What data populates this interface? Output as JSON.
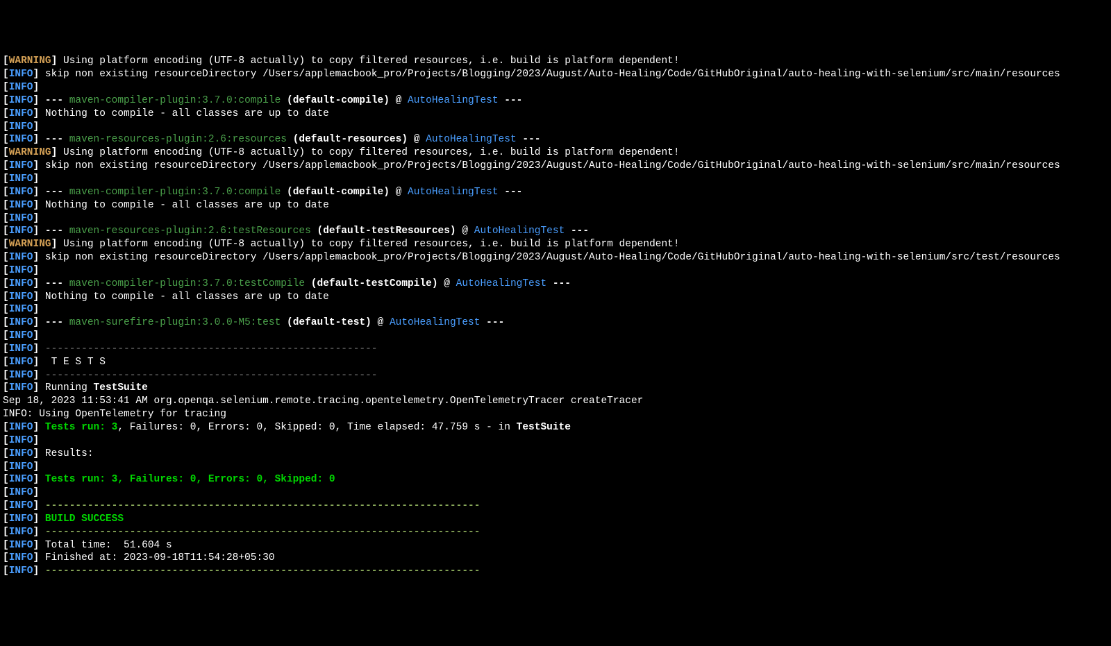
{
  "lines": [
    {
      "parts": [
        {
          "t": "[",
          "c": "bracket"
        },
        {
          "t": "WARNING",
          "c": "warning"
        },
        {
          "t": "] ",
          "c": "bracket"
        },
        {
          "t": "Using platform encoding (UTF-8 actually) to copy filtered resources, i.e. build is platform dependent!",
          "c": "plain"
        }
      ]
    },
    {
      "parts": [
        {
          "t": "[",
          "c": "bracket"
        },
        {
          "t": "INFO",
          "c": "info"
        },
        {
          "t": "] ",
          "c": "bracket"
        },
        {
          "t": "skip non existing resourceDirectory /Users/applemacbook_pro/Projects/Blogging/2023/August/Auto-Healing/Code/GitHubOriginal/auto-healing-with-selenium/src/main/resources",
          "c": "plain"
        }
      ]
    },
    {
      "parts": [
        {
          "t": "[",
          "c": "bracket"
        },
        {
          "t": "INFO",
          "c": "info"
        },
        {
          "t": "]",
          "c": "bracket"
        }
      ]
    },
    {
      "parts": [
        {
          "t": "[",
          "c": "bracket"
        },
        {
          "t": "INFO",
          "c": "info"
        },
        {
          "t": "] ",
          "c": "bracket"
        },
        {
          "t": "--- ",
          "c": "bold"
        },
        {
          "t": "maven-compiler-plugin:3.7.0:compile",
          "c": "darkgreen"
        },
        {
          "t": " (default-compile) ",
          "c": "bold"
        },
        {
          "t": "@ ",
          "c": "plain"
        },
        {
          "t": "AutoHealingTest",
          "c": "blue-project"
        },
        {
          "t": " ---",
          "c": "bold"
        }
      ]
    },
    {
      "parts": [
        {
          "t": "[",
          "c": "bracket"
        },
        {
          "t": "INFO",
          "c": "info"
        },
        {
          "t": "] ",
          "c": "bracket"
        },
        {
          "t": "Nothing to compile - all classes are up to date",
          "c": "plain"
        }
      ]
    },
    {
      "parts": [
        {
          "t": "[",
          "c": "bracket"
        },
        {
          "t": "INFO",
          "c": "info"
        },
        {
          "t": "]",
          "c": "bracket"
        }
      ]
    },
    {
      "parts": [
        {
          "t": "[",
          "c": "bracket"
        },
        {
          "t": "INFO",
          "c": "info"
        },
        {
          "t": "] ",
          "c": "bracket"
        },
        {
          "t": "--- ",
          "c": "bold"
        },
        {
          "t": "maven-resources-plugin:2.6:resources",
          "c": "darkgreen"
        },
        {
          "t": " (default-resources) ",
          "c": "bold"
        },
        {
          "t": "@ ",
          "c": "plain"
        },
        {
          "t": "AutoHealingTest",
          "c": "blue-project"
        },
        {
          "t": " ---",
          "c": "bold"
        }
      ]
    },
    {
      "parts": [
        {
          "t": "[",
          "c": "bracket"
        },
        {
          "t": "WARNING",
          "c": "warning"
        },
        {
          "t": "] ",
          "c": "bracket"
        },
        {
          "t": "Using platform encoding (UTF-8 actually) to copy filtered resources, i.e. build is platform dependent!",
          "c": "plain"
        }
      ]
    },
    {
      "parts": [
        {
          "t": "[",
          "c": "bracket"
        },
        {
          "t": "INFO",
          "c": "info"
        },
        {
          "t": "] ",
          "c": "bracket"
        },
        {
          "t": "skip non existing resourceDirectory /Users/applemacbook_pro/Projects/Blogging/2023/August/Auto-Healing/Code/GitHubOriginal/auto-healing-with-selenium/src/main/resources",
          "c": "plain"
        }
      ]
    },
    {
      "parts": [
        {
          "t": "[",
          "c": "bracket"
        },
        {
          "t": "INFO",
          "c": "info"
        },
        {
          "t": "]",
          "c": "bracket"
        }
      ]
    },
    {
      "parts": [
        {
          "t": "[",
          "c": "bracket"
        },
        {
          "t": "INFO",
          "c": "info"
        },
        {
          "t": "] ",
          "c": "bracket"
        },
        {
          "t": "--- ",
          "c": "bold"
        },
        {
          "t": "maven-compiler-plugin:3.7.0:compile",
          "c": "darkgreen"
        },
        {
          "t": " (default-compile) ",
          "c": "bold"
        },
        {
          "t": "@ ",
          "c": "plain"
        },
        {
          "t": "AutoHealingTest",
          "c": "blue-project"
        },
        {
          "t": " ---",
          "c": "bold"
        }
      ]
    },
    {
      "parts": [
        {
          "t": "[",
          "c": "bracket"
        },
        {
          "t": "INFO",
          "c": "info"
        },
        {
          "t": "] ",
          "c": "bracket"
        },
        {
          "t": "Nothing to compile - all classes are up to date",
          "c": "plain"
        }
      ]
    },
    {
      "parts": [
        {
          "t": "[",
          "c": "bracket"
        },
        {
          "t": "INFO",
          "c": "info"
        },
        {
          "t": "]",
          "c": "bracket"
        }
      ]
    },
    {
      "parts": [
        {
          "t": "[",
          "c": "bracket"
        },
        {
          "t": "INFO",
          "c": "info"
        },
        {
          "t": "] ",
          "c": "bracket"
        },
        {
          "t": "--- ",
          "c": "bold"
        },
        {
          "t": "maven-resources-plugin:2.6:testResources",
          "c": "darkgreen"
        },
        {
          "t": " (default-testResources) ",
          "c": "bold"
        },
        {
          "t": "@ ",
          "c": "plain"
        },
        {
          "t": "AutoHealingTest",
          "c": "blue-project"
        },
        {
          "t": " ---",
          "c": "bold"
        }
      ]
    },
    {
      "parts": [
        {
          "t": "[",
          "c": "bracket"
        },
        {
          "t": "WARNING",
          "c": "warning"
        },
        {
          "t": "] ",
          "c": "bracket"
        },
        {
          "t": "Using platform encoding (UTF-8 actually) to copy filtered resources, i.e. build is platform dependent!",
          "c": "plain"
        }
      ]
    },
    {
      "parts": [
        {
          "t": "[",
          "c": "bracket"
        },
        {
          "t": "INFO",
          "c": "info"
        },
        {
          "t": "] ",
          "c": "bracket"
        },
        {
          "t": "skip non existing resourceDirectory /Users/applemacbook_pro/Projects/Blogging/2023/August/Auto-Healing/Code/GitHubOriginal/auto-healing-with-selenium/src/test/resources",
          "c": "plain"
        }
      ]
    },
    {
      "parts": [
        {
          "t": "[",
          "c": "bracket"
        },
        {
          "t": "INFO",
          "c": "info"
        },
        {
          "t": "]",
          "c": "bracket"
        }
      ]
    },
    {
      "parts": [
        {
          "t": "[",
          "c": "bracket"
        },
        {
          "t": "INFO",
          "c": "info"
        },
        {
          "t": "] ",
          "c": "bracket"
        },
        {
          "t": "--- ",
          "c": "bold"
        },
        {
          "t": "maven-compiler-plugin:3.7.0:testCompile",
          "c": "darkgreen"
        },
        {
          "t": " (default-testCompile) ",
          "c": "bold"
        },
        {
          "t": "@ ",
          "c": "plain"
        },
        {
          "t": "AutoHealingTest",
          "c": "blue-project"
        },
        {
          "t": " ---",
          "c": "bold"
        }
      ]
    },
    {
      "parts": [
        {
          "t": "[",
          "c": "bracket"
        },
        {
          "t": "INFO",
          "c": "info"
        },
        {
          "t": "] ",
          "c": "bracket"
        },
        {
          "t": "Nothing to compile - all classes are up to date",
          "c": "plain"
        }
      ]
    },
    {
      "parts": [
        {
          "t": "[",
          "c": "bracket"
        },
        {
          "t": "INFO",
          "c": "info"
        },
        {
          "t": "]",
          "c": "bracket"
        }
      ]
    },
    {
      "parts": [
        {
          "t": "[",
          "c": "bracket"
        },
        {
          "t": "INFO",
          "c": "info"
        },
        {
          "t": "] ",
          "c": "bracket"
        },
        {
          "t": "--- ",
          "c": "bold"
        },
        {
          "t": "maven-surefire-plugin:3.0.0-M5:test",
          "c": "darkgreen"
        },
        {
          "t": " (default-test) ",
          "c": "bold"
        },
        {
          "t": "@ ",
          "c": "plain"
        },
        {
          "t": "AutoHealingTest",
          "c": "blue-project"
        },
        {
          "t": " ---",
          "c": "bold"
        }
      ]
    },
    {
      "parts": [
        {
          "t": "[",
          "c": "bracket"
        },
        {
          "t": "INFO",
          "c": "info"
        },
        {
          "t": "]",
          "c": "bracket"
        }
      ]
    },
    {
      "parts": [
        {
          "t": "[",
          "c": "bracket"
        },
        {
          "t": "INFO",
          "c": "info"
        },
        {
          "t": "] ",
          "c": "bracket"
        },
        {
          "t": "-------------------------------------------------------",
          "c": "sep-dark"
        }
      ]
    },
    {
      "parts": [
        {
          "t": "[",
          "c": "bracket"
        },
        {
          "t": "INFO",
          "c": "info"
        },
        {
          "t": "] ",
          "c": "bracket"
        },
        {
          "t": " T E S T S",
          "c": "plain"
        }
      ]
    },
    {
      "parts": [
        {
          "t": "[",
          "c": "bracket"
        },
        {
          "t": "INFO",
          "c": "info"
        },
        {
          "t": "] ",
          "c": "bracket"
        },
        {
          "t": "-------------------------------------------------------",
          "c": "sep-dark"
        }
      ]
    },
    {
      "parts": [
        {
          "t": "[",
          "c": "bracket"
        },
        {
          "t": "INFO",
          "c": "info"
        },
        {
          "t": "] ",
          "c": "bracket"
        },
        {
          "t": "Running ",
          "c": "plain"
        },
        {
          "t": "TestSuite",
          "c": "bold"
        }
      ]
    },
    {
      "parts": [
        {
          "t": "Sep 18, 2023 11:53:41 AM org.openqa.selenium.remote.tracing.opentelemetry.OpenTelemetryTracer createTracer",
          "c": "plain"
        }
      ]
    },
    {
      "parts": [
        {
          "t": "INFO: Using OpenTelemetry for tracing",
          "c": "plain"
        }
      ]
    },
    {
      "parts": [
        {
          "t": "[",
          "c": "bracket"
        },
        {
          "t": "INFO",
          "c": "info"
        },
        {
          "t": "] ",
          "c": "bracket"
        },
        {
          "t": "Tests run: 3",
          "c": "green"
        },
        {
          "t": ", Failures: 0, Errors: 0, Skipped: 0, Time elapsed: 47.759 s - in ",
          "c": "plain"
        },
        {
          "t": "TestSuite",
          "c": "bold"
        }
      ]
    },
    {
      "parts": [
        {
          "t": "[",
          "c": "bracket"
        },
        {
          "t": "INFO",
          "c": "info"
        },
        {
          "t": "]",
          "c": "bracket"
        }
      ]
    },
    {
      "parts": [
        {
          "t": "[",
          "c": "bracket"
        },
        {
          "t": "INFO",
          "c": "info"
        },
        {
          "t": "] ",
          "c": "bracket"
        },
        {
          "t": "Results:",
          "c": "plain"
        }
      ]
    },
    {
      "parts": [
        {
          "t": "[",
          "c": "bracket"
        },
        {
          "t": "INFO",
          "c": "info"
        },
        {
          "t": "]",
          "c": "bracket"
        }
      ]
    },
    {
      "parts": [
        {
          "t": "[",
          "c": "bracket"
        },
        {
          "t": "INFO",
          "c": "info"
        },
        {
          "t": "] ",
          "c": "bracket"
        },
        {
          "t": "Tests run: 3, Failures: 0, Errors: 0, Skipped: 0",
          "c": "green"
        }
      ]
    },
    {
      "parts": [
        {
          "t": "[",
          "c": "bracket"
        },
        {
          "t": "INFO",
          "c": "info"
        },
        {
          "t": "]",
          "c": "bracket"
        }
      ]
    },
    {
      "parts": [
        {
          "t": "[",
          "c": "bracket"
        },
        {
          "t": "INFO",
          "c": "info"
        },
        {
          "t": "] ",
          "c": "bracket"
        },
        {
          "t": "------------------------------------------------------------------------",
          "c": "sep-green"
        }
      ]
    },
    {
      "parts": [
        {
          "t": "[",
          "c": "bracket"
        },
        {
          "t": "INFO",
          "c": "info"
        },
        {
          "t": "] ",
          "c": "bracket"
        },
        {
          "t": "BUILD SUCCESS",
          "c": "green"
        }
      ]
    },
    {
      "parts": [
        {
          "t": "[",
          "c": "bracket"
        },
        {
          "t": "INFO",
          "c": "info"
        },
        {
          "t": "] ",
          "c": "bracket"
        },
        {
          "t": "------------------------------------------------------------------------",
          "c": "sep-green"
        }
      ]
    },
    {
      "parts": [
        {
          "t": "[",
          "c": "bracket"
        },
        {
          "t": "INFO",
          "c": "info"
        },
        {
          "t": "] ",
          "c": "bracket"
        },
        {
          "t": "Total time:  51.604 s",
          "c": "plain"
        }
      ]
    },
    {
      "parts": [
        {
          "t": "[",
          "c": "bracket"
        },
        {
          "t": "INFO",
          "c": "info"
        },
        {
          "t": "] ",
          "c": "bracket"
        },
        {
          "t": "Finished at: 2023-09-18T11:54:28+05:30",
          "c": "plain"
        }
      ]
    },
    {
      "parts": [
        {
          "t": "[",
          "c": "bracket"
        },
        {
          "t": "INFO",
          "c": "info"
        },
        {
          "t": "] ",
          "c": "bracket"
        },
        {
          "t": "------------------------------------------------------------------------",
          "c": "sep-green"
        }
      ]
    }
  ]
}
